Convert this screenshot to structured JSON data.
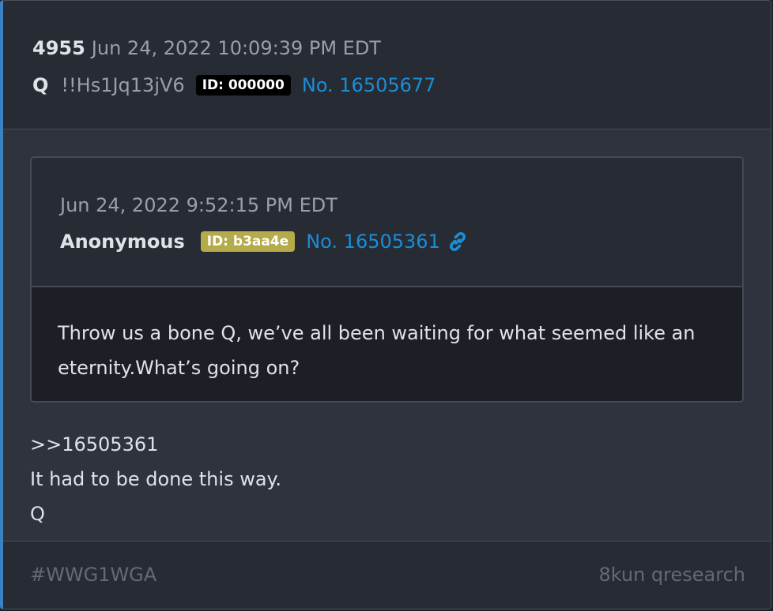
{
  "post": {
    "count": "4955",
    "date": "Jun 24, 2022 10:09:39 PM EDT",
    "author": "Q",
    "tripcode": "!!Hs1Jq13jV6",
    "id_badge": "ID: 000000",
    "number": "No. 16505677"
  },
  "quoted": {
    "date": "Jun 24, 2022 9:52:15 PM EDT",
    "author": "Anonymous",
    "id_badge": "ID: b3aa4e",
    "number": "No. 16505361",
    "link_icon": "link-icon",
    "text": "Throw us a bone Q, we’ve all been waiting for what seemed like an eternity.What’s going on?"
  },
  "reply": {
    "lines": [
      ">>16505361",
      "It had to be done this way.",
      "Q"
    ]
  },
  "footer": {
    "hashtag": "#WWG1WGA",
    "source": "8kun qresearch"
  },
  "colors": {
    "accent_left_border": "#3b82c4",
    "link_blue": "#1a8ed8",
    "id_black": "#000000",
    "id_gold": "#b5ab4a"
  }
}
